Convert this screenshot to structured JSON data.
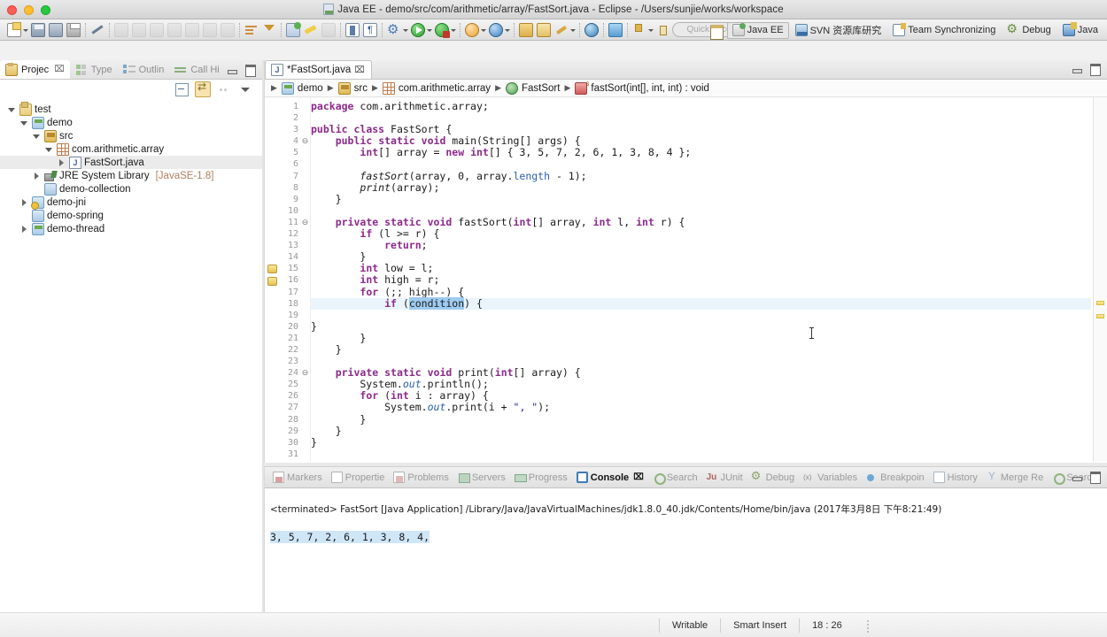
{
  "window": {
    "title": "Java EE - demo/src/com/arithmetic/array/FastSort.java - Eclipse - /Users/sunjie/works/workspace"
  },
  "toolbar": {
    "quick_access_placeholder": "Quick Access",
    "buttons": [
      {
        "name": "new-button",
        "icon": "new-document-icon",
        "dropdown": true
      },
      {
        "name": "save-button",
        "icon": "save-icon",
        "dropdown": false
      },
      {
        "name": "save-all-button",
        "icon": "save-all-icon",
        "dropdown": false
      },
      {
        "name": "print-button",
        "icon": "print-icon",
        "dropdown": false
      },
      {
        "name": "sep",
        "icon": "separator",
        "dropdown": false
      },
      {
        "name": "annotate-button",
        "icon": "pen-icon",
        "dropdown": false
      },
      {
        "name": "sep",
        "icon": "separator",
        "dropdown": false
      },
      {
        "name": "resume-button",
        "icon": "resume-icon-disabled",
        "dropdown": false
      },
      {
        "name": "suspend-button",
        "icon": "suspend-icon-disabled",
        "dropdown": false
      },
      {
        "name": "terminate-button",
        "icon": "terminate-icon-disabled",
        "dropdown": false
      },
      {
        "name": "step-into-button",
        "icon": "step-into-icon-disabled",
        "dropdown": false
      },
      {
        "name": "step-over-button",
        "icon": "step-over-icon-disabled",
        "dropdown": false
      },
      {
        "name": "step-return-button",
        "icon": "step-return-icon-disabled",
        "dropdown": false
      },
      {
        "name": "drop-to-frame-button",
        "icon": "drop-to-frame-icon-disabled",
        "dropdown": false
      },
      {
        "name": "sep",
        "icon": "separator",
        "dropdown": false
      },
      {
        "name": "skip-breakpoints-button",
        "icon": "breakpoints-bar-icon",
        "dropdown": false
      },
      {
        "name": "filter-button",
        "icon": "filter-icon",
        "dropdown": false
      },
      {
        "name": "sep",
        "icon": "separator",
        "dropdown": false
      },
      {
        "name": "navigate-button",
        "icon": "navigate-green-icon",
        "dropdown": false
      },
      {
        "name": "brush-button",
        "icon": "brush-icon",
        "dropdown": false
      },
      {
        "name": "disabled-button",
        "icon": "disabled-icon",
        "dropdown": false
      },
      {
        "name": "sep",
        "icon": "separator",
        "dropdown": false
      },
      {
        "name": "toggle-block-selection-button",
        "icon": "block-selection-icon",
        "dropdown": false
      },
      {
        "name": "show-whitespace-button",
        "icon": "pilcrow-icon",
        "dropdown": false
      },
      {
        "name": "sep",
        "icon": "separator",
        "dropdown": false
      },
      {
        "name": "external-tools-button",
        "icon": "gear-icon",
        "dropdown": true
      },
      {
        "name": "run-button",
        "icon": "run-icon",
        "dropdown": true
      },
      {
        "name": "debug-button",
        "icon": "debug-icon",
        "dropdown": true
      },
      {
        "name": "sep",
        "icon": "separator",
        "dropdown": false
      },
      {
        "name": "run-on-server-button",
        "icon": "globe-orange-icon",
        "dropdown": true
      },
      {
        "name": "profile-button",
        "icon": "blue-ball-icon",
        "dropdown": true
      },
      {
        "name": "sep",
        "icon": "separator",
        "dropdown": false
      },
      {
        "name": "new-java-project-button",
        "icon": "folder-pie-icon",
        "dropdown": false
      },
      {
        "name": "new-package-button",
        "icon": "folder-open-icon",
        "dropdown": false
      },
      {
        "name": "quick-fix-button",
        "icon": "wrench-icon",
        "dropdown": true
      },
      {
        "name": "sep",
        "icon": "separator",
        "dropdown": false
      },
      {
        "name": "open-web-browser-button",
        "icon": "earth-icon",
        "dropdown": false
      },
      {
        "name": "sep",
        "icon": "separator",
        "dropdown": false
      },
      {
        "name": "synchronize-button",
        "icon": "people-sync-icon",
        "dropdown": false
      },
      {
        "name": "sep",
        "icon": "separator",
        "dropdown": false
      },
      {
        "name": "commit-button",
        "icon": "down-arrow-icon",
        "dropdown": true
      },
      {
        "name": "update-button",
        "icon": "up-arrow-icon",
        "dropdown": true
      },
      {
        "name": "sep",
        "icon": "separator",
        "dropdown": false
      },
      {
        "name": "back-button",
        "icon": "left-arrow-icon",
        "dropdown": false
      },
      {
        "name": "forward-button",
        "icon": "left-arrow-icon",
        "dropdown": true
      }
    ]
  },
  "perspectives": {
    "open_perspective_label": "",
    "items": [
      {
        "label": "Java EE",
        "icon": "java-ee-perspective-icon",
        "active": true
      },
      {
        "label": "SVN 资源库研究",
        "icon": "svn-perspective-icon",
        "active": false
      },
      {
        "label": "Team Synchronizing",
        "icon": "team-sync-perspective-icon",
        "active": false
      },
      {
        "label": "Debug",
        "icon": "debug-perspective-icon",
        "active": false
      },
      {
        "label": "Java",
        "icon": "java-perspective-icon",
        "active": false
      }
    ]
  },
  "left_panel": {
    "tabs": [
      {
        "label": "Projec",
        "icon": "project-explorer-icon",
        "active": true,
        "close": "⌧"
      },
      {
        "label": "Type",
        "icon": "type-hierarchy-icon",
        "active": false
      },
      {
        "label": "Outlin",
        "icon": "outline-icon",
        "active": false
      },
      {
        "label": "Call Hi",
        "icon": "call-hierarchy-icon",
        "active": false
      }
    ],
    "tree": [
      {
        "label": "test",
        "indent": 0,
        "twisty": "down",
        "icon": "java-project-icon",
        "selected": false
      },
      {
        "label": "demo",
        "indent": 1,
        "twisty": "down",
        "icon": "project-folder-icon",
        "selected": false
      },
      {
        "label": "src",
        "indent": 2,
        "twisty": "down",
        "icon": "source-folder-icon",
        "selected": false
      },
      {
        "label": "com.arithmetic.array",
        "indent": 3,
        "twisty": "down",
        "icon": "package-icon",
        "selected": false
      },
      {
        "label": "FastSort.java",
        "indent": 4,
        "twisty": "right",
        "icon": "java-file-icon",
        "selected": true
      },
      {
        "label": "JRE System Library",
        "suffix": "[JavaSE-1.8]",
        "indent": 2,
        "twisty": "right",
        "icon": "jre-library-icon",
        "selected": false
      },
      {
        "label": "demo-collection",
        "indent": 2,
        "twisty": "none",
        "icon": "plain-folder-icon",
        "selected": false
      },
      {
        "label": "demo-jni",
        "indent": 1,
        "twisty": "right",
        "icon": "jni-project-icon",
        "selected": false
      },
      {
        "label": "demo-spring",
        "indent": 1,
        "twisty": "none",
        "icon": "plain-folder-icon",
        "selected": false
      },
      {
        "label": "demo-thread",
        "indent": 1,
        "twisty": "right",
        "icon": "project-folder-icon",
        "selected": false
      }
    ]
  },
  "editor": {
    "tab_label": "*FastSort.java",
    "tab_close": "⌧",
    "breadcrumb": [
      {
        "label": "demo",
        "icon": "project-folder-icon"
      },
      {
        "label": "src",
        "icon": "source-folder-icon"
      },
      {
        "label": "com.arithmetic.array",
        "icon": "package-icon"
      },
      {
        "label": "FastSort",
        "icon": "class-icon"
      },
      {
        "label": "fastSort(int[], int, int) : void",
        "icon": "method-icon"
      }
    ],
    "lines": [
      {
        "n": 1,
        "fold": "",
        "html": "<span class=\"kw\">package</span> com.arithmetic.array;"
      },
      {
        "n": 2,
        "fold": "",
        "html": ""
      },
      {
        "n": 3,
        "fold": "",
        "html": "<span class=\"kw\">public</span> <span class=\"kw\">class</span> FastSort {"
      },
      {
        "n": 4,
        "fold": "-",
        "html": "    <span class=\"kw\">public</span> <span class=\"kw\">static</span> <span class=\"kw\">void</span> main(String[] args) {"
      },
      {
        "n": 5,
        "fold": "",
        "html": "        <span class=\"kw\">int</span>[] array = <span class=\"kw\">new</span> <span class=\"kw\">int</span>[] { 3, 5, 7, 2, 6, 1, 3, 8, 4 };"
      },
      {
        "n": 6,
        "fold": "",
        "html": ""
      },
      {
        "n": 7,
        "fold": "",
        "html": "        <span class=\"mtd\">fastSort</span>(array, 0, array.<span class=\"fld\">length</span> - 1);"
      },
      {
        "n": 8,
        "fold": "",
        "html": "        <span class=\"mtd\">print</span>(array);"
      },
      {
        "n": 9,
        "fold": "",
        "html": "    }"
      },
      {
        "n": 10,
        "fold": "",
        "html": ""
      },
      {
        "n": 11,
        "fold": "-",
        "html": "    <span class=\"kw\">private</span> <span class=\"kw\">static</span> <span class=\"kw\">void</span> fastSort(<span class=\"kw\">int</span>[] array, <span class=\"kw\">int</span> l, <span class=\"kw\">int</span> r) {"
      },
      {
        "n": 12,
        "fold": "",
        "html": "        <span class=\"kw\">if</span> (l &gt;= r) {"
      },
      {
        "n": 13,
        "fold": "",
        "html": "            <span class=\"kw\">return</span>;"
      },
      {
        "n": 14,
        "fold": "",
        "html": "        }"
      },
      {
        "n": 15,
        "fold": "",
        "html": "        <span class=\"kw\">int</span> low = l;",
        "marker": "warning"
      },
      {
        "n": 16,
        "fold": "",
        "html": "        <span class=\"kw\">int</span> high = r;",
        "marker": "warning"
      },
      {
        "n": 17,
        "fold": "",
        "html": "        <span class=\"kw\">for</span> (;; high--) {"
      },
      {
        "n": 18,
        "fold": "",
        "html": "            <span class=\"kw\">if</span> (<span class=\"sel\">condition</span>) {",
        "current": true
      },
      {
        "n": 19,
        "fold": "",
        "html": ""
      },
      {
        "n": 20,
        "fold": "",
        "html": "}"
      },
      {
        "n": 21,
        "fold": "",
        "html": "        }"
      },
      {
        "n": 22,
        "fold": "",
        "html": "    }"
      },
      {
        "n": 23,
        "fold": "",
        "html": ""
      },
      {
        "n": 24,
        "fold": "-",
        "html": "    <span class=\"kw\">private</span> <span class=\"kw\">static</span> <span class=\"kw\">void</span> print(<span class=\"kw\">int</span>[] array) {"
      },
      {
        "n": 25,
        "fold": "",
        "html": "        System.<span class=\"stf\">out</span>.println();"
      },
      {
        "n": 26,
        "fold": "",
        "html": "        <span class=\"kw\">for</span> (<span class=\"kw\">int</span> i : array) {"
      },
      {
        "n": 27,
        "fold": "",
        "html": "            System.<span class=\"stf\">out</span>.print(i + <span class=\"str\">\", \"</span>);"
      },
      {
        "n": 28,
        "fold": "",
        "html": "        }"
      },
      {
        "n": 29,
        "fold": "",
        "html": "    }"
      },
      {
        "n": 30,
        "fold": "",
        "html": "}"
      },
      {
        "n": 31,
        "fold": "",
        "html": ""
      }
    ]
  },
  "console": {
    "tabs": [
      {
        "label": "Markers",
        "icon": "markers-icon",
        "active": false
      },
      {
        "label": "Propertie",
        "icon": "properties-icon",
        "active": false
      },
      {
        "label": "Problems",
        "icon": "problems-icon",
        "active": false
      },
      {
        "label": "Servers",
        "icon": "servers-icon",
        "active": false
      },
      {
        "label": "Progress",
        "icon": "progress-icon",
        "active": false
      },
      {
        "label": "Console",
        "icon": "console-icon",
        "active": true,
        "close": "⌧"
      },
      {
        "label": "Search",
        "icon": "search-icon",
        "active": false
      },
      {
        "label": "JUnit",
        "icon": "junit-icon",
        "active": false
      },
      {
        "label": "Debug",
        "icon": "debug-icon",
        "active": false
      },
      {
        "label": "Variables",
        "icon": "variables-icon",
        "active": false
      },
      {
        "label": "Breakpoin",
        "icon": "breakpoints-icon",
        "active": false
      },
      {
        "label": "History",
        "icon": "history-icon",
        "active": false
      },
      {
        "label": "Merge Re",
        "icon": "merge-results-icon",
        "active": false
      },
      {
        "label": "Search",
        "icon": "search-icon",
        "active": false
      }
    ],
    "header": "<terminated> FastSort [Java Application] /Library/Java/JavaVirtualMachines/jdk1.8.0_40.jdk/Contents/Home/bin/java (2017年3月8日 下午8:21:49)",
    "output": "3, 5, 7, 2, 6, 1, 3, 8, 4, ",
    "toolbar": [
      {
        "name": "terminate-button",
        "icon": "stop-icon",
        "boxed": false,
        "dropdown": false
      },
      {
        "name": "remove-launch-button",
        "icon": "remove-icon",
        "boxed": false,
        "dropdown": false
      },
      {
        "name": "remove-all-terminated-button",
        "icon": "remove-all-icon",
        "boxed": false,
        "dropdown": false
      },
      {
        "name": "clear-console-button",
        "icon": "clear-console-icon",
        "boxed": false,
        "dropdown": false
      },
      {
        "name": "lock-scroll-button",
        "icon": "lock-scroll-icon",
        "boxed": false,
        "dropdown": false
      },
      {
        "name": "scroll-lock-button",
        "icon": "scroll-lock-icon",
        "boxed": true,
        "dropdown": false
      },
      {
        "name": "show-console-on-output-button",
        "icon": "show-console-icon",
        "boxed": false,
        "dropdown": false
      },
      {
        "name": "pin-console-button",
        "icon": "pin-console-icon",
        "boxed": false,
        "dropdown": false
      },
      {
        "name": "display-selected-console-button",
        "icon": "display-console-icon",
        "boxed": false,
        "dropdown": true
      },
      {
        "name": "open-console-button",
        "icon": "new-console-icon",
        "boxed": false,
        "dropdown": true
      }
    ]
  },
  "statusbar": {
    "writable": "Writable",
    "insert_mode": "Smart Insert",
    "position": "18 : 26"
  }
}
